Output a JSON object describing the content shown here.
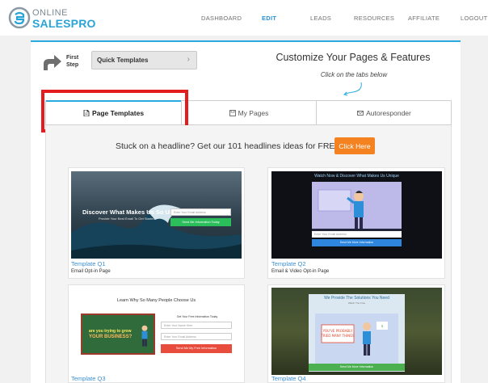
{
  "brand": {
    "online": "ONLINE",
    "sales_pro": "SALESPRO"
  },
  "nav": [
    {
      "label": "DASHBOARD"
    },
    {
      "label": "EDIT"
    },
    {
      "label": "LEADS"
    },
    {
      "label": "RESOURCES"
    },
    {
      "label": "AFFILIATE"
    },
    {
      "label": "LOGOUT"
    }
  ],
  "first_step": {
    "line1": "First",
    "line2": "Step",
    "button": "Quick Templates"
  },
  "customize": {
    "title": "Customize Your Pages & Features",
    "subtitle": "Click on the tabs below"
  },
  "tabs": [
    {
      "label": "Page Templates",
      "icon": "document-icon"
    },
    {
      "label": "My Pages",
      "icon": "save-icon"
    },
    {
      "label": "Autoresponder",
      "icon": "envelope-icon"
    }
  ],
  "promo": {
    "text": "Stuck on a headline? Get our 101 headlines ideas for FREE!",
    "button": "Click Here"
  },
  "templates": [
    {
      "name": "Template Q1",
      "desc": "Email Opt-in Page",
      "preview": {
        "headline": "Discover What Makes Us So Unique",
        "sub": "Provide Your Best Email To Get Started",
        "input": "Enter Your Email Address",
        "button": "Send Me Information Today"
      }
    },
    {
      "name": "Template Q2",
      "desc": "Email & Video Opt-in Page",
      "preview": {
        "headline": "Watch Now & Discover What Makes Us Unique",
        "input": "Enter Your Email Address",
        "button": "Send Me More Information"
      }
    },
    {
      "name": "Template Q3",
      "desc": "",
      "preview": {
        "headline": "Learn Why So Many People Choose Us",
        "board1": "are you trying to grow",
        "board2": "YOUR BUSINESS?",
        "form_title": "Get Your Free Information Today",
        "input1": "Enter Your Name Here",
        "input2": "Enter Your Email Address",
        "button": "Send Me My Free Information"
      }
    },
    {
      "name": "Template Q4",
      "desc": "",
      "preview": {
        "headline": "We Provide The Solutions You Need",
        "sub": "Watch The Free",
        "button": "Send Me More Information"
      }
    }
  ],
  "colors": {
    "accent": "#29a9e0",
    "highlight": "#e31d1d",
    "cta": "#f58220"
  }
}
